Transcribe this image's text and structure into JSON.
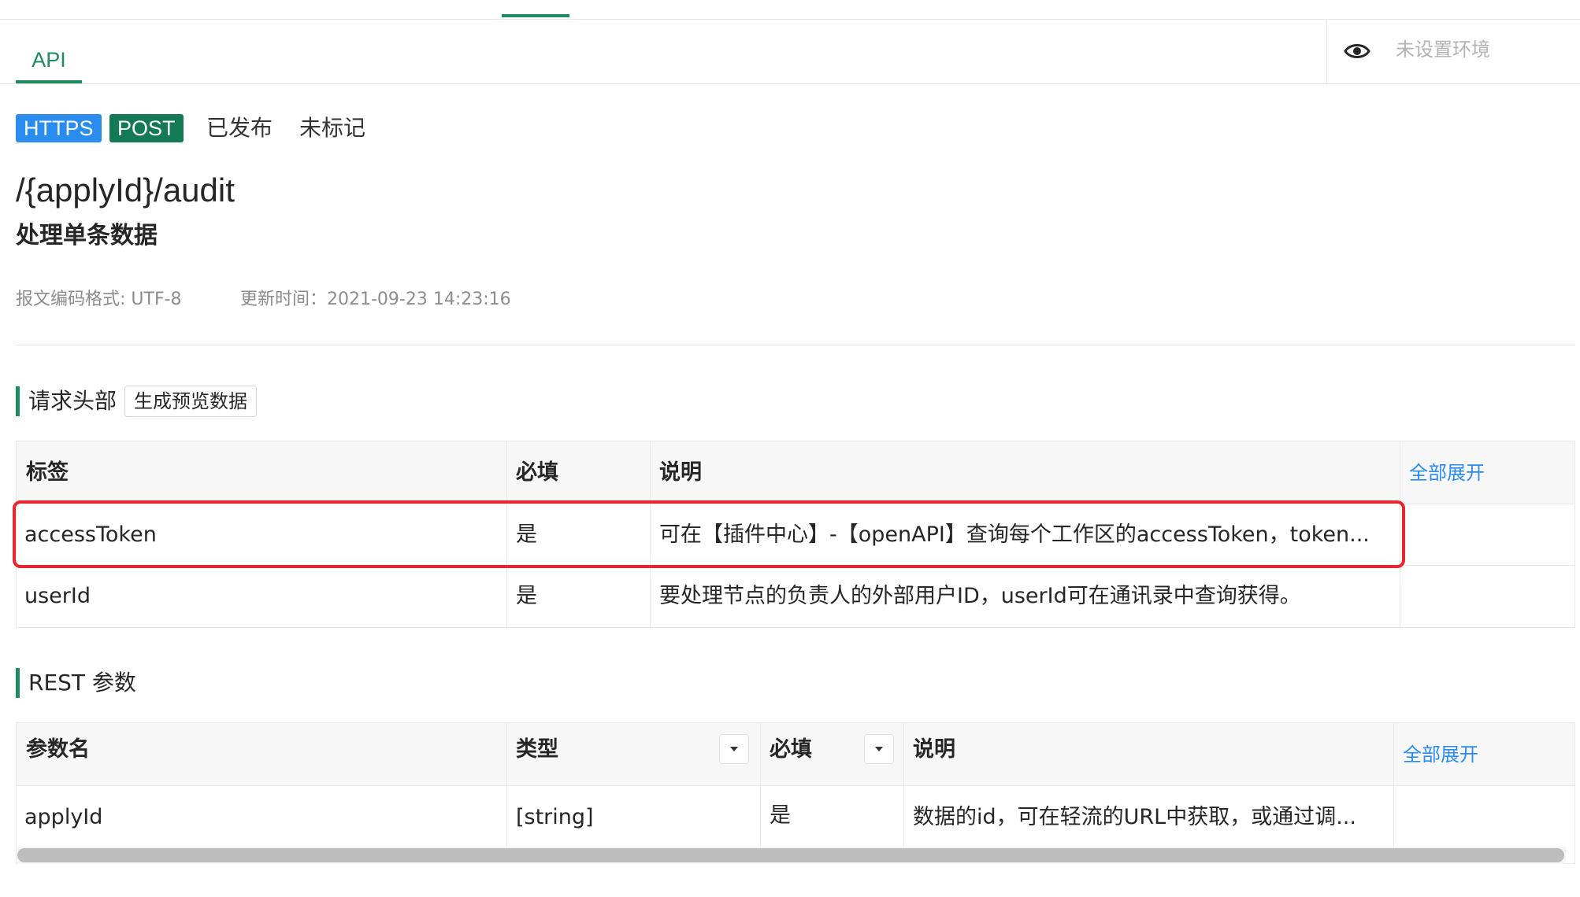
{
  "tabs": {
    "api_label": "API"
  },
  "environment": {
    "label": "未设置环境",
    "icon": "eye-icon"
  },
  "endpoint": {
    "protocol_badge": "HTTPS",
    "method_badge": "POST",
    "publish_status": "已发布",
    "mark_status": "未标记",
    "path": "/{applyId}/audit",
    "title": "处理单条数据",
    "encoding": "报文编码格式: UTF-8",
    "updated": "更新时间：2021-09-23 14:23:16"
  },
  "colors": {
    "accent": "#1f8a5f",
    "https_badge": "#2b8cf0",
    "post_badge": "#137a55",
    "link": "#2b8cf0",
    "highlight": "#e8262d"
  },
  "request_headers": {
    "section_title": "请求头部",
    "generate_button": "生成预览数据",
    "columns": {
      "label": "标签",
      "required": "必填",
      "description": "说明",
      "expand_all": "全部展开"
    },
    "rows": [
      {
        "label": "accessToken",
        "required": "是",
        "description": "可在【插件中心】-【openAPI】查询每个工作区的accessToken，token..."
      },
      {
        "label": "userId",
        "required": "是",
        "description": "要处理节点的负责人的外部用户ID，userId可在通讯录中查询获得。"
      }
    ]
  },
  "rest_params": {
    "section_title": "REST 参数",
    "columns": {
      "name": "参数名",
      "type": "类型",
      "required": "必填",
      "description": "说明",
      "expand_all": "全部展开"
    },
    "rows": [
      {
        "name": "applyId",
        "type": "[string]",
        "required": "是",
        "description": "数据的id，可在轻流的URL中获取，或通过调..."
      }
    ]
  }
}
